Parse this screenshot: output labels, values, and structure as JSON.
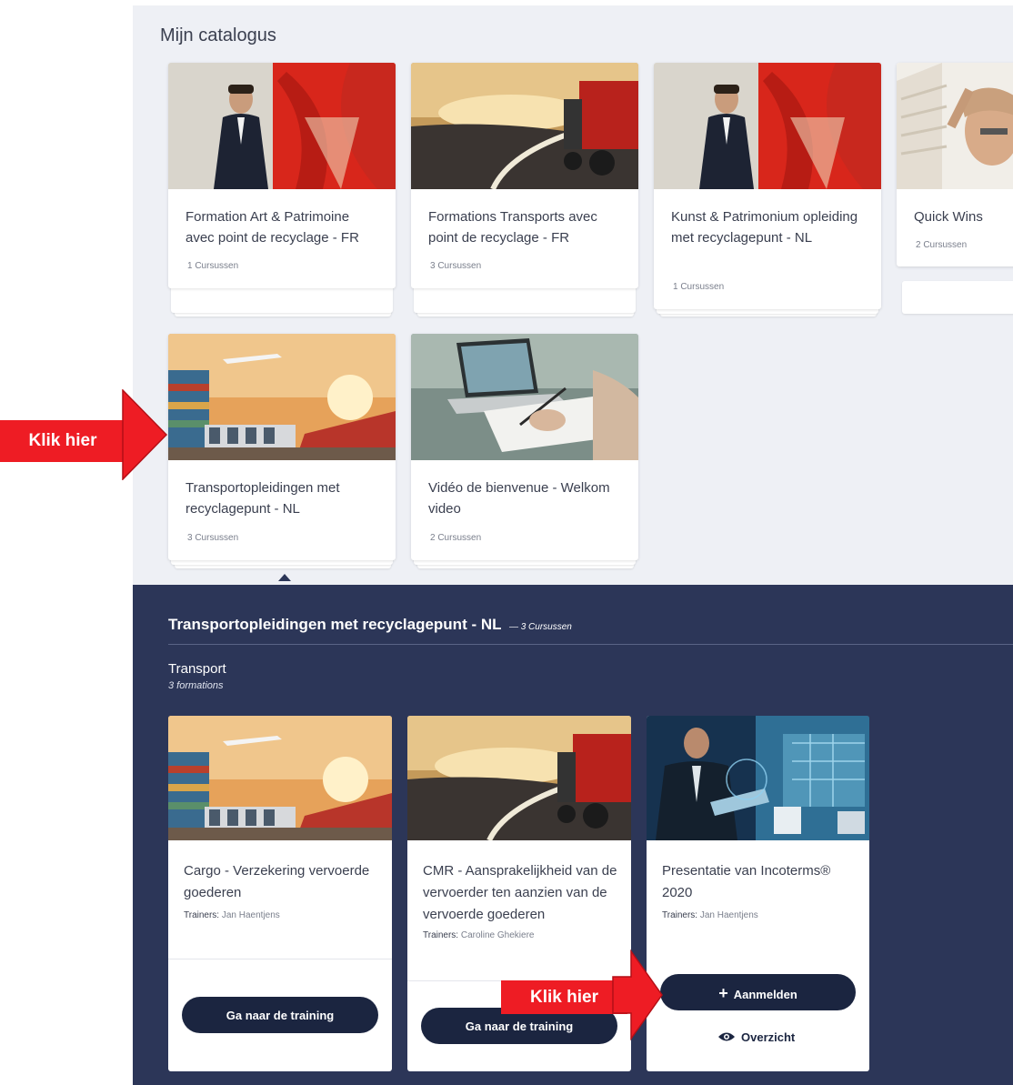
{
  "catalog": {
    "title": "Mijn catalogus",
    "items": [
      {
        "title": "Formation Art & Patrimoine avec point de recyclage - FR",
        "count": "1 Cursussen"
      },
      {
        "title": "Formations Transports avec point de recyclage - FR",
        "count": "3 Cursussen"
      },
      {
        "title": "Kunst & Patrimonium opleiding met recyclagepunt - NL",
        "count": "1 Cursussen"
      },
      {
        "title": "Quick Wins",
        "count": "2 Cursussen"
      },
      {
        "title": "Transportopleidingen met recyclagepunt - NL",
        "count": "3 Cursussen"
      },
      {
        "title": "Vidéo de bienvenue - Welkom video",
        "count": "2 Cursussen"
      }
    ]
  },
  "detail": {
    "title": "Transportopleidingen met recyclagepunt - NL",
    "count": "3 Cursussen",
    "section": {
      "title": "Transport",
      "subtitle": "3 formations"
    },
    "trainers_label": "Trainers:",
    "courses": [
      {
        "title": "Cargo - Verzekering vervoerde goederen",
        "trainer": "Jan Haentjens",
        "button": "Ga naar de training"
      },
      {
        "title": "CMR - Aansprakelijkheid van de vervoerder ten aanzien van de vervoerde goederen",
        "trainer": "Caroline Ghekiere",
        "button": "Ga naar de training"
      },
      {
        "title": "Presentatie van Incoterms® 2020",
        "trainer": "Jan Haentjens",
        "button": "Aanmelden",
        "secondary": "Overzicht"
      }
    ]
  },
  "annotations": {
    "left": "Klik hier",
    "bottom": "Klik hier",
    "color": "#ee1c24"
  },
  "icons": {
    "enroll": "plus-icon",
    "overview": "eye-icon"
  }
}
